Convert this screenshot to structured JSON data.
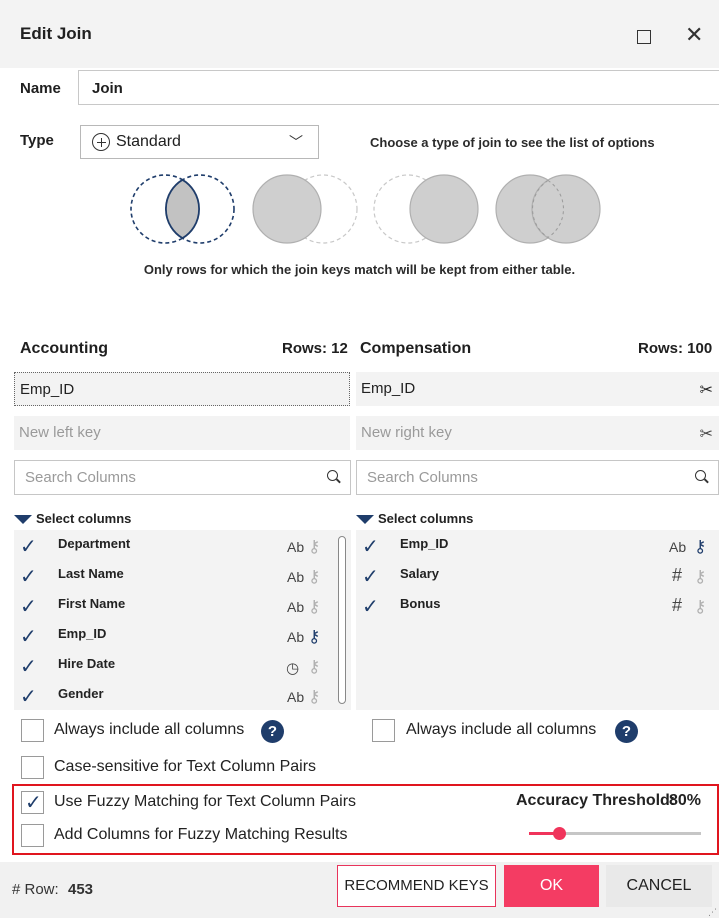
{
  "dialog": {
    "title": "Edit Join"
  },
  "name": {
    "label": "Name",
    "value": "Join"
  },
  "type": {
    "label": "Type",
    "value": "Standard",
    "hint": "Choose a type of join to see the list of options",
    "description": "Only rows for which the join keys match will be kept from either table."
  },
  "left": {
    "table": "Accounting",
    "rows": "Rows: 12",
    "keys": [
      "Emp_ID"
    ],
    "new_key_placeholder": "New left key",
    "search_placeholder": "Search Columns",
    "select_label": "Select columns",
    "columns": [
      {
        "name": "Department",
        "type": "Ab",
        "key": false
      },
      {
        "name": "Last Name",
        "type": "Ab",
        "key": false
      },
      {
        "name": "First Name",
        "type": "Ab",
        "key": false
      },
      {
        "name": "Emp_ID",
        "type": "Ab",
        "key": true
      },
      {
        "name": "Hire Date",
        "type": "clock",
        "key": false
      },
      {
        "name": "Gender",
        "type": "Ab",
        "key": false
      }
    ],
    "always_include_label": "Always include all columns"
  },
  "right": {
    "table": "Compensation",
    "rows": "Rows: 100",
    "keys": [
      "Emp_ID"
    ],
    "new_key_placeholder": "New right key",
    "search_placeholder": "Search Columns",
    "select_label": "Select columns",
    "columns": [
      {
        "name": "Emp_ID",
        "type": "Ab",
        "key": true
      },
      {
        "name": "Salary",
        "type": "#",
        "key": false
      },
      {
        "name": "Bonus",
        "type": "#",
        "key": false
      }
    ],
    "always_include_label": "Always include all columns"
  },
  "options": {
    "case_sensitive_label": "Case-sensitive for Text Column Pairs",
    "fuzzy_label": "Use Fuzzy Matching for Text Column Pairs",
    "fuzzy_checked": true,
    "fuzzy_columns_label": "Add Columns for Fuzzy Matching Results",
    "accuracy_label": "Accuracy Threshold:",
    "accuracy_value": "80%",
    "accuracy_fraction": 0.8
  },
  "footer": {
    "row_label": "# Row:",
    "row_count": "453",
    "recommend_label": "RECOMMEND KEYS",
    "ok_label": "OK",
    "cancel_label": "CANCEL"
  },
  "colors": {
    "accent": "#f43c63",
    "navy": "#1f3d6b",
    "highlight_frame": "#e0151e"
  },
  "icons": [
    "maximize-icon",
    "close-icon",
    "plus-circle-icon",
    "chevron-down-icon",
    "scissors-icon",
    "search-icon",
    "key-icon",
    "clock-icon",
    "help-icon",
    "checkmark-icon"
  ]
}
